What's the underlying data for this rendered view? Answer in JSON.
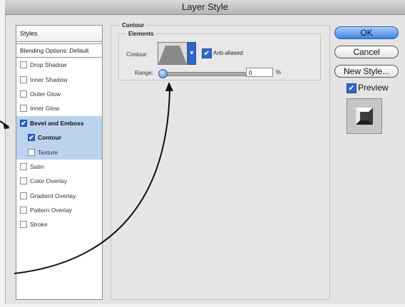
{
  "window": {
    "title": "Layer Style"
  },
  "styles_panel": {
    "header": "Styles",
    "blending_options": "Blending Options: Default",
    "items": [
      {
        "label": "Drop Shadow",
        "checked": false,
        "active": false,
        "sub": false,
        "bold": false
      },
      {
        "label": "Inner Shadow",
        "checked": false,
        "active": false,
        "sub": false,
        "bold": false
      },
      {
        "label": "Outer Glow",
        "checked": false,
        "active": false,
        "sub": false,
        "bold": false
      },
      {
        "label": "Inner Glow",
        "checked": false,
        "active": false,
        "sub": false,
        "bold": false
      },
      {
        "label": "Bevel and Emboss",
        "checked": true,
        "active": true,
        "sub": false,
        "bold": true
      },
      {
        "label": "Contour",
        "checked": true,
        "active": true,
        "sub": true,
        "bold": true
      },
      {
        "label": "Texture",
        "checked": false,
        "active": true,
        "sub": true,
        "bold": false
      },
      {
        "label": "Satin",
        "checked": false,
        "active": false,
        "sub": false,
        "bold": false
      },
      {
        "label": "Color Overlay",
        "checked": false,
        "active": false,
        "sub": false,
        "bold": false
      },
      {
        "label": "Gradient Overlay",
        "checked": false,
        "active": false,
        "sub": false,
        "bold": false
      },
      {
        "label": "Pattern Overlay",
        "checked": false,
        "active": false,
        "sub": false,
        "bold": false
      },
      {
        "label": "Stroke",
        "checked": false,
        "active": false,
        "sub": false,
        "bold": false
      }
    ]
  },
  "contour_section": {
    "title": "Contour",
    "elements_title": "Elements",
    "contour_label": "Contour:",
    "anti_aliased_label": "Anti-aliased",
    "anti_aliased_checked": true,
    "range_label": "Range:",
    "range_value": "0",
    "range_unit": "%"
  },
  "buttons": {
    "ok": "OK",
    "cancel": "Cancel",
    "new_style": "New Style...",
    "preview_label": "Preview",
    "preview_checked": true
  },
  "colors": {
    "accent": "#3e82e1",
    "selected_row": "#bcd3ee"
  }
}
